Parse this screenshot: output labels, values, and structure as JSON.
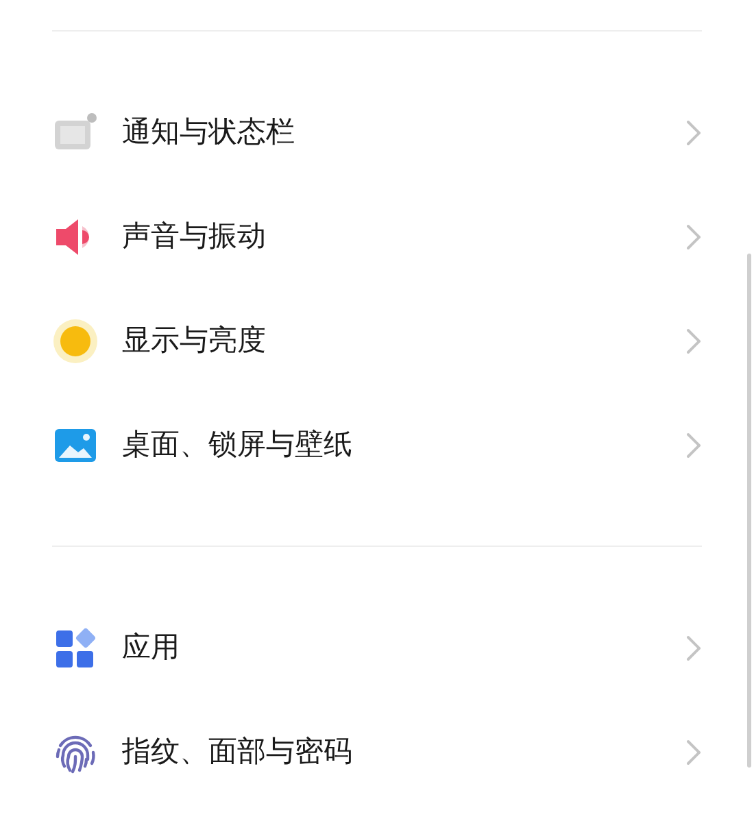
{
  "groups": [
    {
      "items": [
        {
          "kind": "notifications",
          "label": "通知与状态栏"
        },
        {
          "kind": "sound",
          "label": "声音与振动"
        },
        {
          "kind": "display",
          "label": "显示与亮度"
        },
        {
          "kind": "wallpaper",
          "label": "桌面、锁屏与壁纸"
        }
      ]
    },
    {
      "items": [
        {
          "kind": "apps",
          "label": "应用"
        },
        {
          "kind": "security",
          "label": "指纹、面部与密码"
        }
      ]
    }
  ]
}
